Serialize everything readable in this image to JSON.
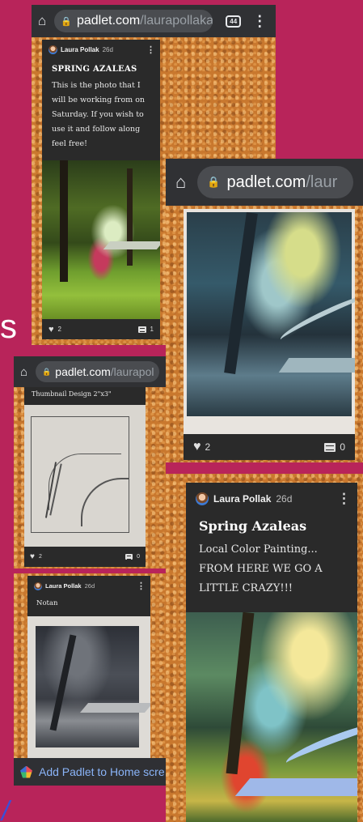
{
  "colors": {
    "background": "#b8245a",
    "browser_bar": "#303134",
    "card": "#2a2a2a",
    "link": "#3a6fd8"
  },
  "shot1": {
    "url_host": "padlet.com",
    "url_path": "/laurapollaka",
    "tab_count": "44",
    "card": {
      "author": "Laura Pollak",
      "age": "26d",
      "title": "SPRING AZALEAS",
      "body": "This is the photo that I will be working from on Saturday.   If you wish to use it and follow along feel free!",
      "likes": "2",
      "comments": "1"
    }
  },
  "shot2": {
    "url_host": "padlet.com",
    "url_path": "/laur",
    "card": {
      "likes": "2",
      "comments": "0"
    }
  },
  "shot3": {
    "url_host": "padlet.com",
    "url_path": "/laurapol",
    "card": {
      "title": "Thumbnail Design 2\"x3\"",
      "likes": "2",
      "comments": "0"
    }
  },
  "shot4": {
    "card": {
      "author": "Laura Pollak",
      "age": "26d",
      "title": "Notan"
    },
    "banner": "Add Padlet to Home scre"
  },
  "shot5": {
    "card": {
      "author": "Laura Pollak",
      "age": "26d",
      "title": "Spring Azaleas",
      "body": "Local Color Painting... FROM HERE WE GO A LITTLE CRAZY!!!"
    }
  },
  "edge_text": {
    "left_letter": "s",
    "bottom_glyph": "/"
  }
}
